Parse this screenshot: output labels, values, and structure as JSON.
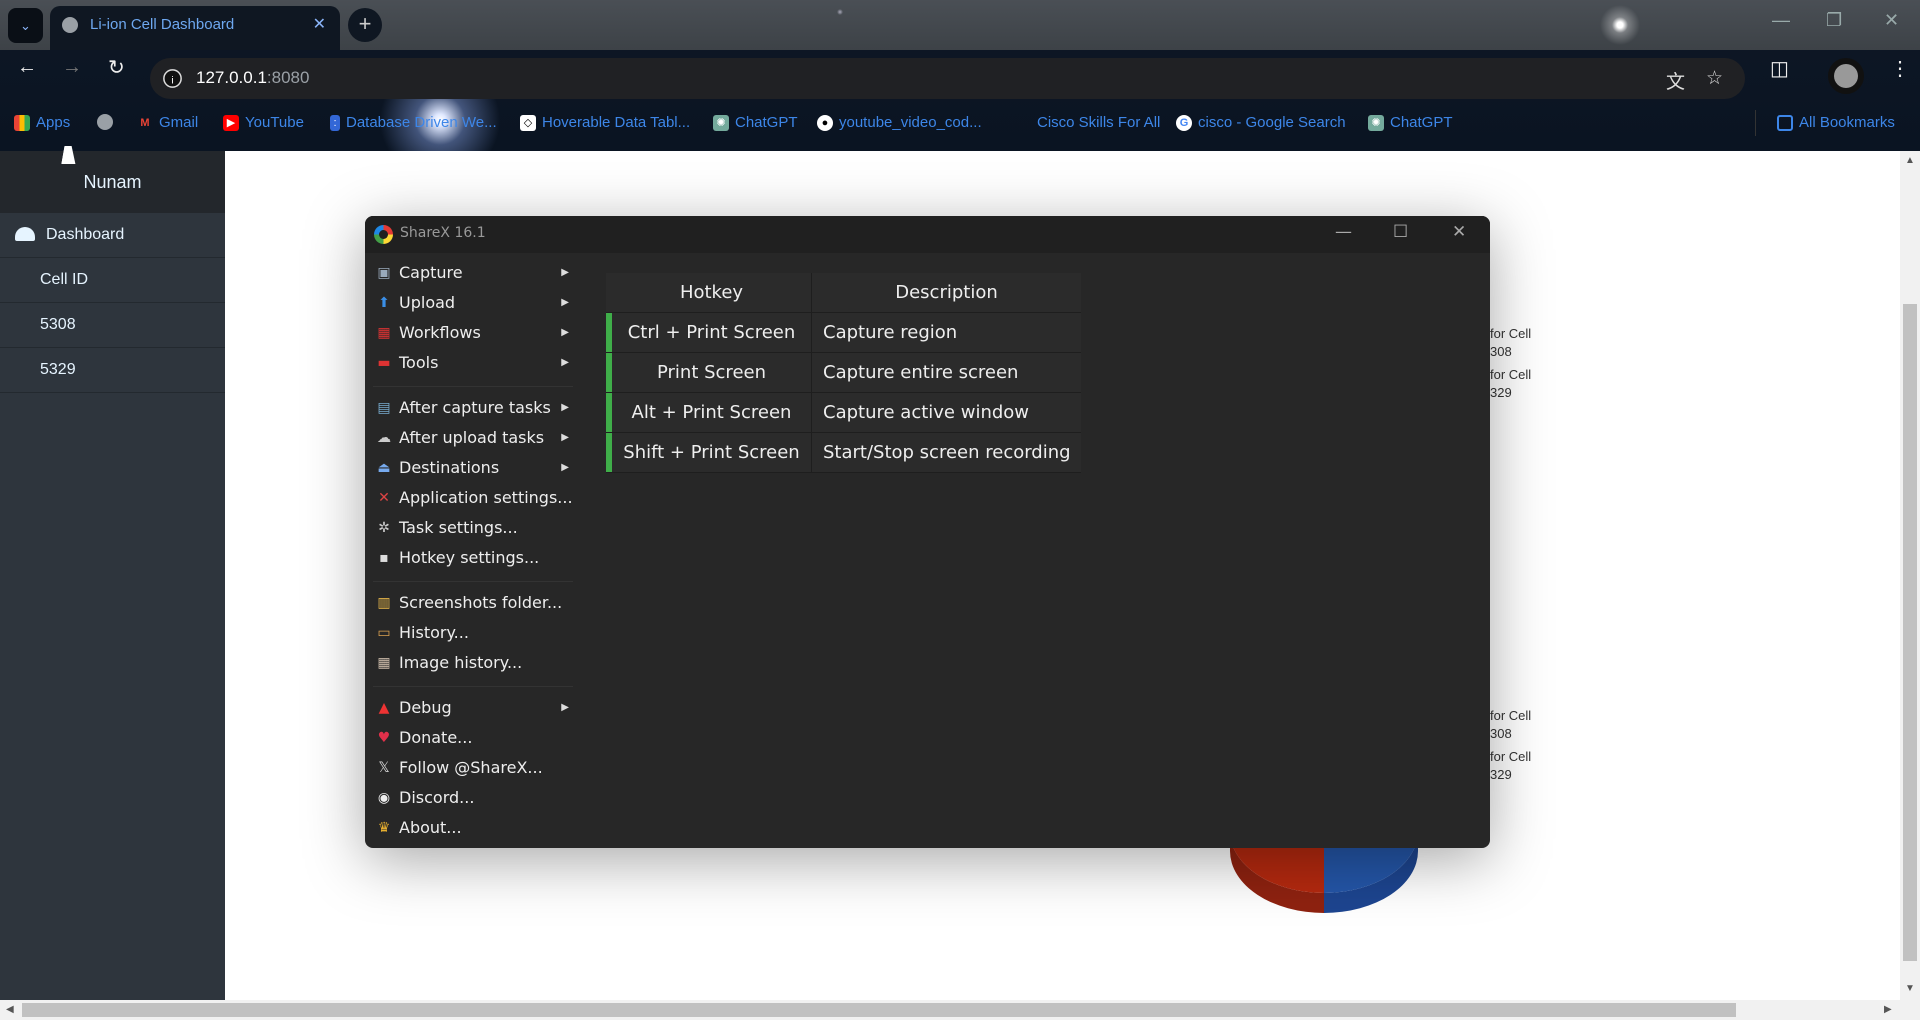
{
  "browser": {
    "tab_title": "Li-ion Cell Dashboard",
    "url_host": "127.0.0.1",
    "url_port": ":8080",
    "bookmarks": [
      {
        "label": "Apps",
        "icon": "apps-grid-icon"
      },
      {
        "label": "",
        "icon": "globe-icon"
      },
      {
        "label": "Gmail",
        "icon": "gmail-icon"
      },
      {
        "label": "YouTube",
        "icon": "youtube-icon"
      },
      {
        "label": "Database Driven We...",
        "icon": "doc-icon"
      },
      {
        "label": "Hoverable Data Tabl...",
        "icon": "codepen-icon"
      },
      {
        "label": "ChatGPT",
        "icon": "chatgpt-icon"
      },
      {
        "label": "youtube_video_cod...",
        "icon": "github-icon"
      },
      {
        "label": "Cisco Skills For All",
        "icon": "cisco-icon"
      },
      {
        "label": "cisco - Google Search",
        "icon": "google-icon"
      },
      {
        "label": "ChatGPT",
        "icon": "chatgpt-icon"
      }
    ],
    "all_bookmarks": "All Bookmarks"
  },
  "sidebar": {
    "brand": "Nunam",
    "items": [
      {
        "label": "Dashboard",
        "icon": "dashboard-gauge-icon"
      },
      {
        "label": "Cell ID"
      },
      {
        "label": "5308"
      },
      {
        "label": "5329"
      }
    ]
  },
  "page": {
    "legend_top": [
      "for Cell",
      "308",
      "for Cell",
      "329"
    ],
    "legend_bottom": [
      "for Cell",
      "308",
      "for Cell",
      "329"
    ],
    "pie_colors": {
      "left": "#b5290f",
      "right": "#2456a8"
    }
  },
  "sharex": {
    "title": "ShareX 16.1",
    "menu": [
      {
        "label": "Capture",
        "icon": "capture-icon",
        "sub": true
      },
      {
        "label": "Upload",
        "icon": "upload-arrow-icon",
        "sub": true
      },
      {
        "label": "Workflows",
        "icon": "workflows-icon",
        "sub": true
      },
      {
        "label": "Tools",
        "icon": "toolbox-icon",
        "sub": true
      },
      {
        "label": "After capture tasks",
        "icon": "after-capture-icon",
        "sub": true
      },
      {
        "label": "After upload tasks",
        "icon": "after-upload-icon",
        "sub": true
      },
      {
        "label": "Destinations",
        "icon": "destinations-icon",
        "sub": true
      },
      {
        "label": "Application settings...",
        "icon": "wrench-screwdriver-icon"
      },
      {
        "label": "Task settings...",
        "icon": "gear-icon"
      },
      {
        "label": "Hotkey settings...",
        "icon": "keyboard-icon"
      },
      {
        "label": "Screenshots folder...",
        "icon": "folder-icon"
      },
      {
        "label": "History...",
        "icon": "history-icon"
      },
      {
        "label": "Image history...",
        "icon": "image-history-icon"
      },
      {
        "label": "Debug",
        "icon": "traffic-cone-icon",
        "sub": true
      },
      {
        "label": "Donate...",
        "icon": "heart-icon"
      },
      {
        "label": "Follow @ShareX...",
        "icon": "x-logo-icon"
      },
      {
        "label": "Discord...",
        "icon": "discord-icon"
      },
      {
        "label": "About...",
        "icon": "crown-icon"
      }
    ],
    "hotkeys": {
      "headers": [
        "Hotkey",
        "Description"
      ],
      "rows": [
        [
          "Ctrl + Print Screen",
          "Capture region"
        ],
        [
          "Print Screen",
          "Capture entire screen"
        ],
        [
          "Alt + Print Screen",
          "Capture active window"
        ],
        [
          "Shift + Print Screen",
          "Start/Stop screen recording"
        ]
      ],
      "status_color": "#3fae49"
    }
  }
}
